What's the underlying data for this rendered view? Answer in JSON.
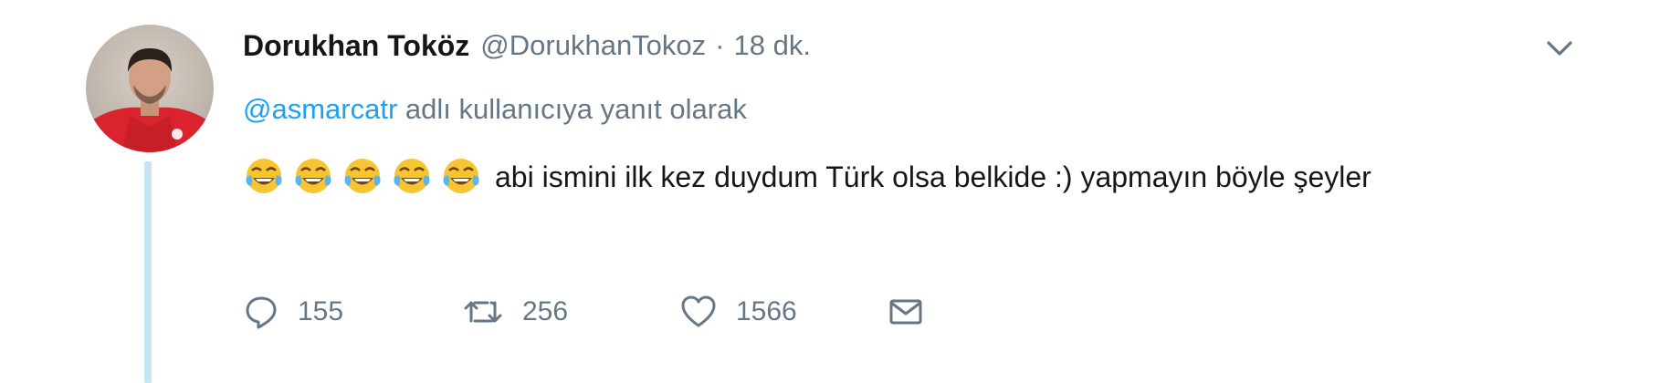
{
  "tweet": {
    "display_name": "Dorukhan Toköz",
    "handle": "@DorukhanTokoz",
    "separator": "·",
    "time": "18 dk.",
    "reply_to": {
      "mention": "@asmarcatr",
      "suffix": "adlı kullanıcıya yanıt olarak"
    },
    "emojis": [
      "face-with-tears-of-joy",
      "face-with-tears-of-joy",
      "face-with-tears-of-joy",
      "face-with-tears-of-joy",
      "face-with-tears-of-joy"
    ],
    "text": "abi ismini ilk kez duydum Türk olsa belkide :) yapmayın böyle şeyler"
  },
  "actions": {
    "reply_count": "155",
    "retweet_count": "256",
    "like_count": "1566"
  },
  "colors": {
    "link": "#1da1f2",
    "muted": "#657786",
    "thread_line": "#c5e4f5",
    "text": "#14171a"
  }
}
